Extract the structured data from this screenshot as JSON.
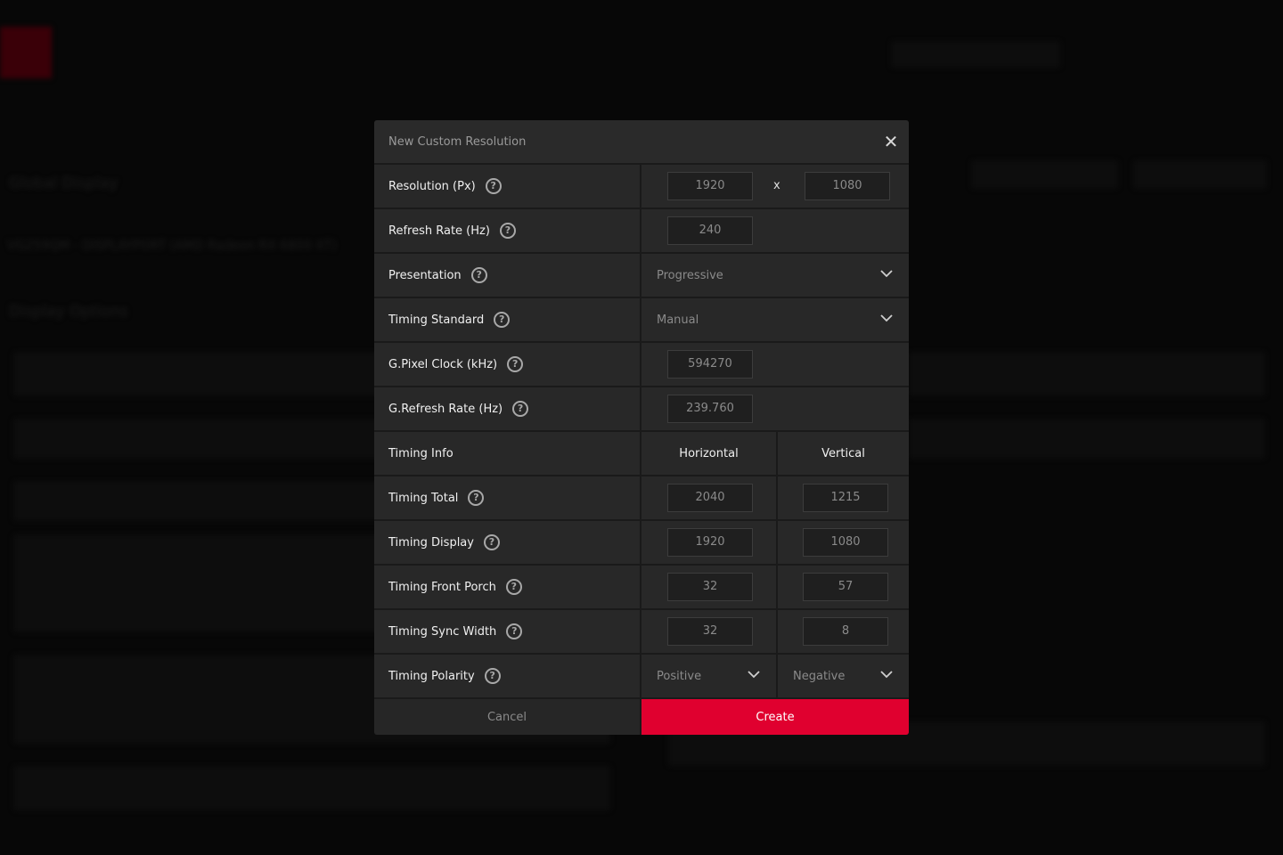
{
  "background": {
    "heading": "Global Display",
    "display_name": "VG259QM - DISPLAYPORT (AMD Radeon RX 6800 XT)",
    "section": "Display Options"
  },
  "dialog": {
    "title": "New Custom Resolution",
    "resolution": {
      "label": "Resolution (Px)",
      "width": "1920",
      "separator": "x",
      "height": "1080"
    },
    "refresh_rate": {
      "label": "Refresh Rate (Hz)",
      "value": "240"
    },
    "presentation": {
      "label": "Presentation",
      "value": "Progressive"
    },
    "timing_standard": {
      "label": "Timing Standard",
      "value": "Manual"
    },
    "pixel_clock": {
      "label": "G.Pixel Clock (kHz)",
      "value": "594270"
    },
    "g_refresh_rate": {
      "label": "G.Refresh Rate (Hz)",
      "value": "239.760"
    },
    "timing_info": {
      "label": "Timing Info",
      "horizontal": "Horizontal",
      "vertical": "Vertical"
    },
    "timing_total": {
      "label": "Timing Total",
      "h": "2040",
      "v": "1215"
    },
    "timing_display": {
      "label": "Timing Display",
      "h": "1920",
      "v": "1080"
    },
    "timing_front_porch": {
      "label": "Timing Front Porch",
      "h": "32",
      "v": "57"
    },
    "timing_sync_width": {
      "label": "Timing Sync Width",
      "h": "32",
      "v": "8"
    },
    "timing_polarity": {
      "label": "Timing Polarity",
      "h": "Positive",
      "v": "Negative"
    },
    "cancel_label": "Cancel",
    "create_label": "Create",
    "help_glyph": "?",
    "close_glyph": "✕"
  },
  "colors": {
    "accent": "#e0002f",
    "dialog_bg": "#282828",
    "overlay": "#070707"
  }
}
